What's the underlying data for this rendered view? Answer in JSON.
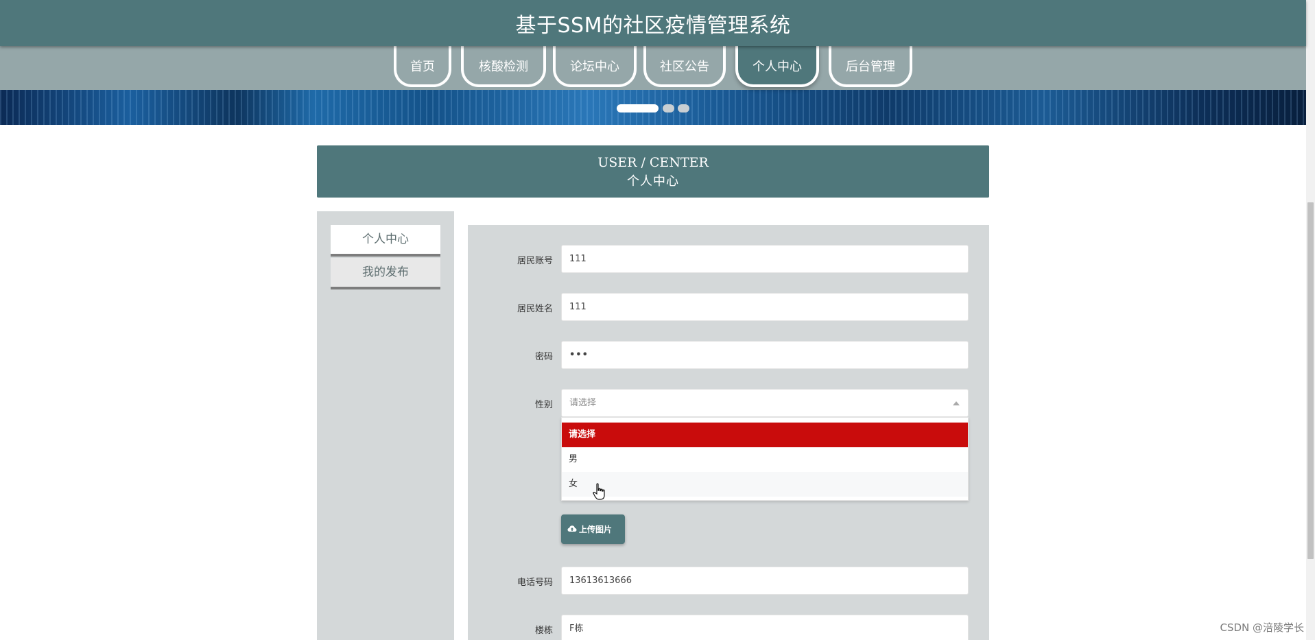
{
  "header": {
    "title": "基于SSM的社区疫情管理系统"
  },
  "nav": {
    "items": [
      "首页",
      "核酸检测",
      "论坛中心",
      "社区公告",
      "个人中心",
      "后台管理"
    ],
    "active": "个人中心"
  },
  "carousel": {
    "slide_count": 3,
    "active_index": 0
  },
  "section": {
    "title_en": "USER / CENTER",
    "title_cn": "个人中心"
  },
  "sidebar": {
    "items": [
      {
        "label": "个人中心",
        "active": true
      },
      {
        "label": "我的发布",
        "active": false
      }
    ]
  },
  "form": {
    "account": {
      "label": "居民账号",
      "value": "111"
    },
    "name": {
      "label": "居民姓名",
      "value": "111"
    },
    "password": {
      "label": "密码",
      "value": "•••"
    },
    "gender": {
      "label": "性别",
      "placeholder": "请选择",
      "options": [
        "请选择",
        "男",
        "女"
      ],
      "highlighted": "请选择",
      "hovered": "女"
    },
    "upload_label": "上传图片",
    "phone": {
      "label": "电话号码",
      "value": "13613613666"
    },
    "building": {
      "label": "楼栋",
      "value": "F栋"
    }
  },
  "icons": {
    "upload": "cloud-upload-icon",
    "cursor": "hand-pointer-icon",
    "select_caret": "caret-up-icon"
  },
  "colors": {
    "primary": "#4f777b",
    "nav_band": "#95a7a9",
    "panel": "#d4d8d9",
    "selected_option": "#c90c0c"
  },
  "watermark": "CSDN @涪陵学长"
}
